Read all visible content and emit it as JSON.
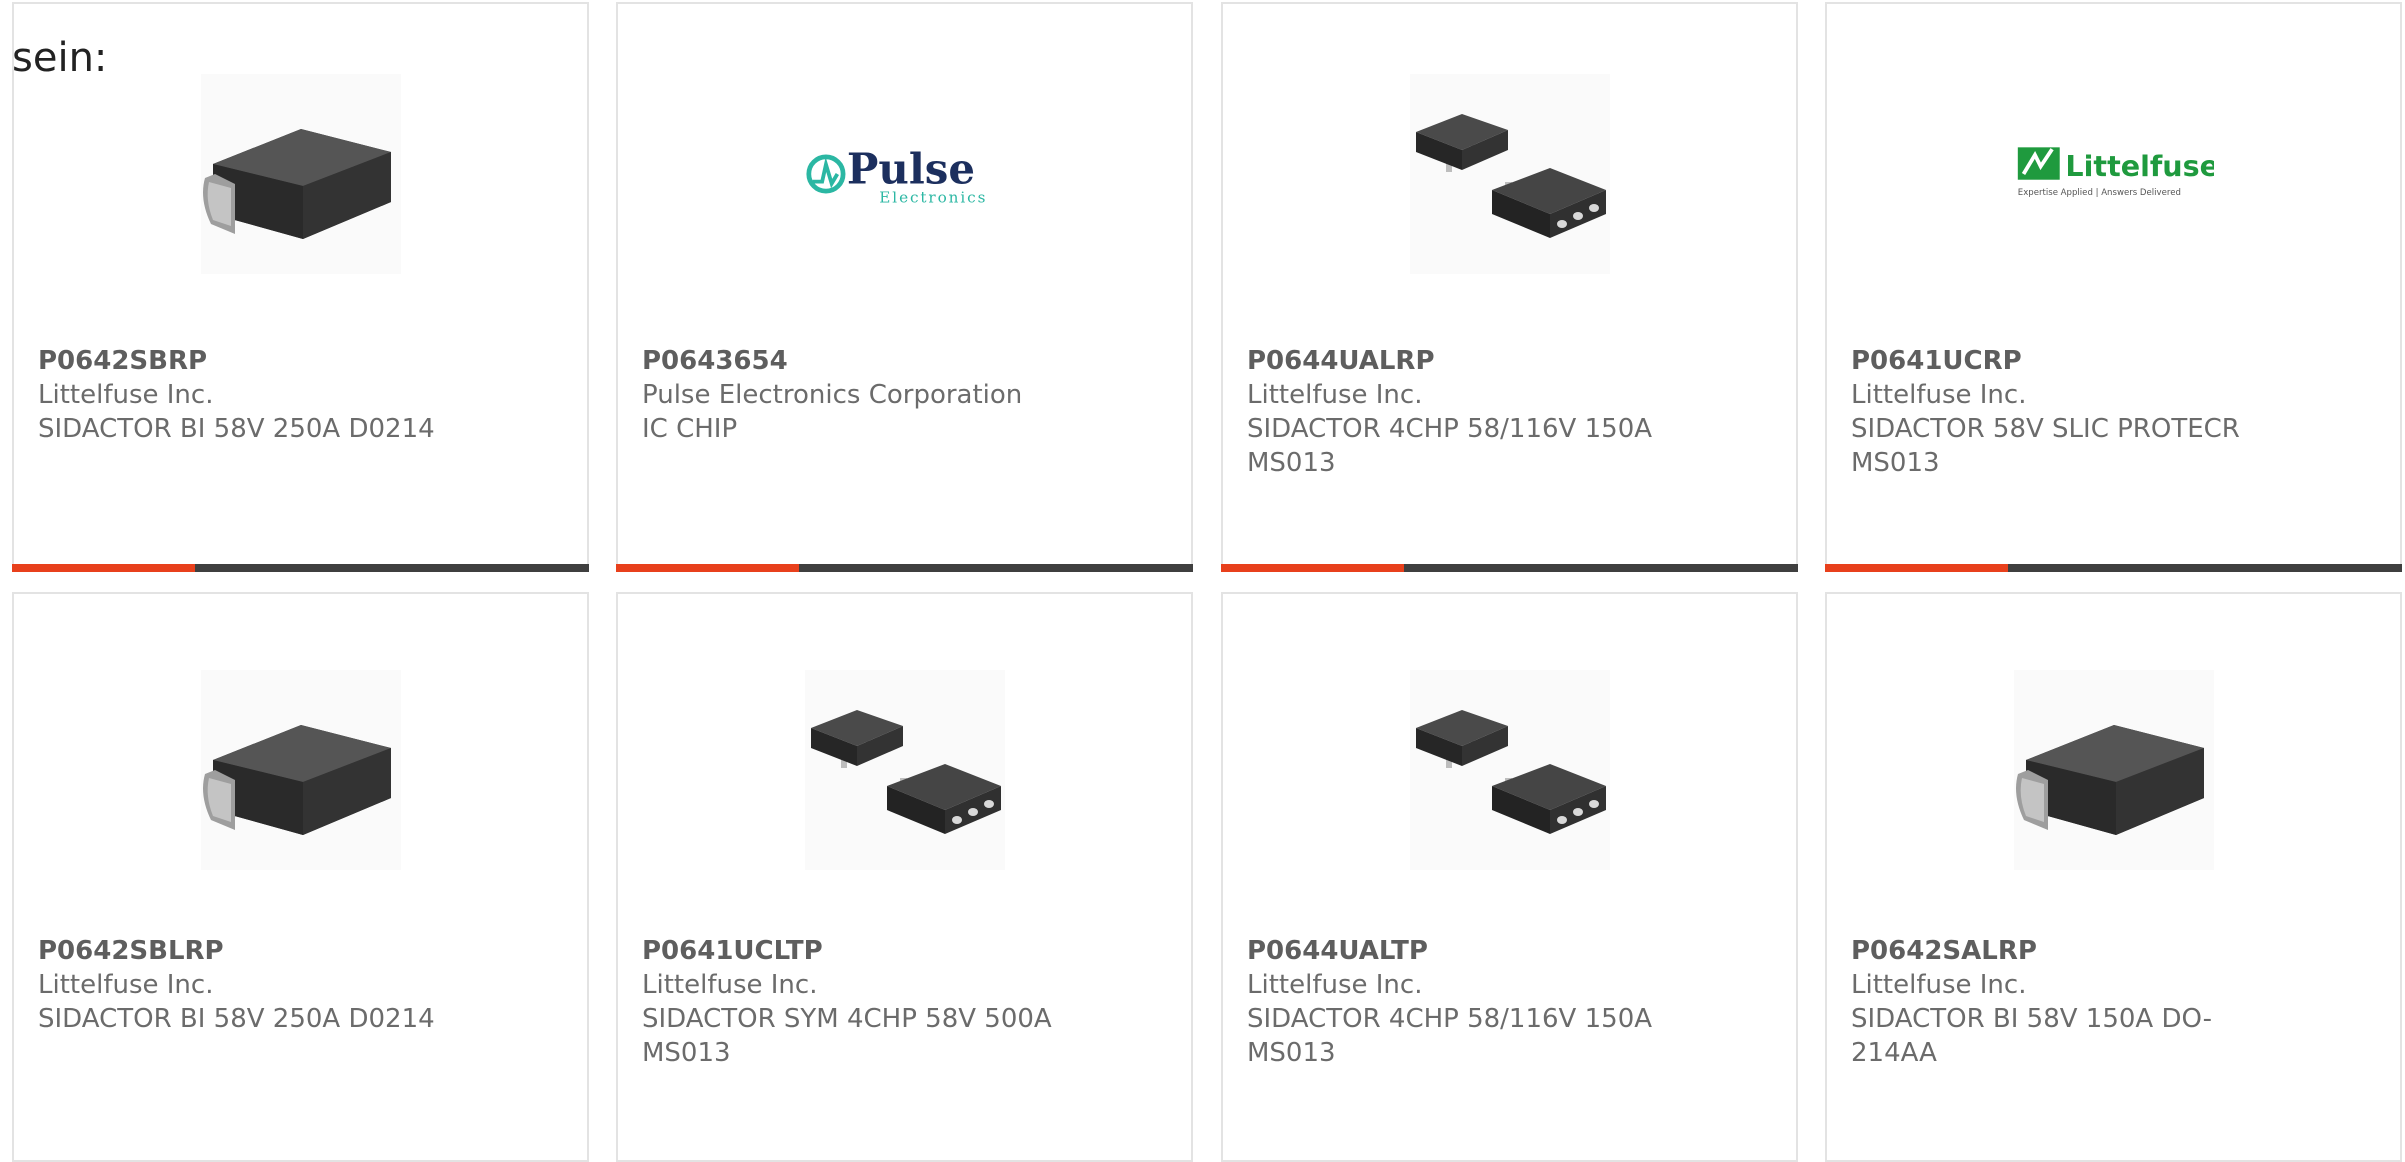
{
  "heading": "sein:",
  "colors": {
    "accent": "#e8401c",
    "bar_dark": "#3f3f3f",
    "text": "#6b6b6b",
    "pulse_teal": "#2bb7a3",
    "littelfuse_green": "#1f9a3e"
  },
  "products": [
    {
      "part": "P0642SBRP",
      "manufacturer": "Littelfuse Inc.",
      "description": "SIDACTOR BI 58V 250A D0214",
      "image": "do214-package-icon"
    },
    {
      "part": "P0643654",
      "manufacturer": "Pulse Electronics Corporation",
      "description": "IC CHIP",
      "image": "pulse-electronics-logo",
      "logo_text": "Pulse",
      "logo_sub": "Electronics"
    },
    {
      "part": "P0644UALRP",
      "manufacturer": "Littelfuse Inc.",
      "description": "SIDACTOR 4CHP 58/116V 150A MS013",
      "image": "ms013-package-icon"
    },
    {
      "part": "P0641UCRP",
      "manufacturer": "Littelfuse Inc.",
      "description": "SIDACTOR 58V SLIC PROTECR MS013",
      "image": "littelfuse-logo",
      "logo_text": "Littelfuse",
      "logo_tagline": "Expertise Applied | Answers Delivered"
    },
    {
      "part": "P0642SBLRP",
      "manufacturer": "Littelfuse Inc.",
      "description": "SIDACTOR BI 58V 250A D0214",
      "image": "do214-package-icon"
    },
    {
      "part": "P0641UCLTP",
      "manufacturer": "Littelfuse Inc.",
      "description": "SIDACTOR SYM 4CHP 58V 500A MS013",
      "image": "ms013-package-icon"
    },
    {
      "part": "P0644UALTP",
      "manufacturer": "Littelfuse Inc.",
      "description": "SIDACTOR 4CHP 58/116V 150A MS013",
      "image": "ms013-package-icon"
    },
    {
      "part": "P0642SALRP",
      "manufacturer": "Littelfuse Inc.",
      "description": "SIDACTOR BI 58V 150A DO-214AA",
      "image": "do214-package-icon"
    }
  ]
}
